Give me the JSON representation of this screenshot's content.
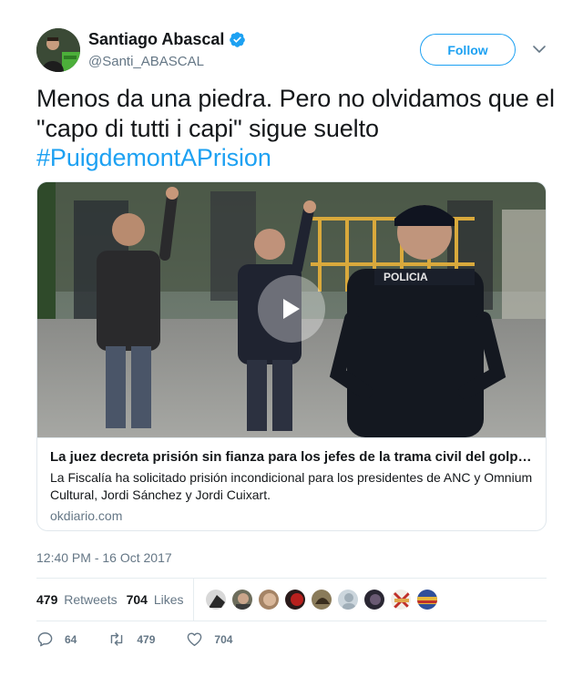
{
  "author": {
    "name": "Santiago Abascal",
    "handle": "@Santi_ABASCAL",
    "verified": true
  },
  "follow_label": "Follow",
  "tweet": {
    "text_main": "Menos da una piedra. Pero no olvidamos que el \"capo di tutti i capi\" sigue suelto",
    "hashtag": "#PuigdemontAPrision"
  },
  "card": {
    "title": "La juez decreta prisión sin fianza para los jefes de la trama civil del golpe: Sánchez y Cuixart",
    "description": "La Fiscalía ha solicitado prisión incondicional para los presidentes de ANC y Omnium Cultural, Jordi Sánchez y Jordi Cuixart.",
    "domain": "okdiario.com",
    "media_type": "video",
    "media_badge": "POLICIA"
  },
  "timestamp": "12:40 PM - 16 Oct 2017",
  "stats": {
    "retweets_count": "479",
    "retweets_label": "Retweets",
    "likes_count": "704",
    "likes_label": "Likes"
  },
  "actions": {
    "reply_count": "64",
    "retweet_count": "479",
    "like_count": "704"
  },
  "icons": {
    "verified": "verified-badge-icon",
    "caret": "chevron-down-icon",
    "play": "play-icon",
    "reply": "reply-icon",
    "retweet": "retweet-icon",
    "like": "heart-icon"
  },
  "colors": {
    "accent": "#1da1f2",
    "text": "#14171a",
    "muted": "#657786",
    "border": "#e1e8ed"
  }
}
